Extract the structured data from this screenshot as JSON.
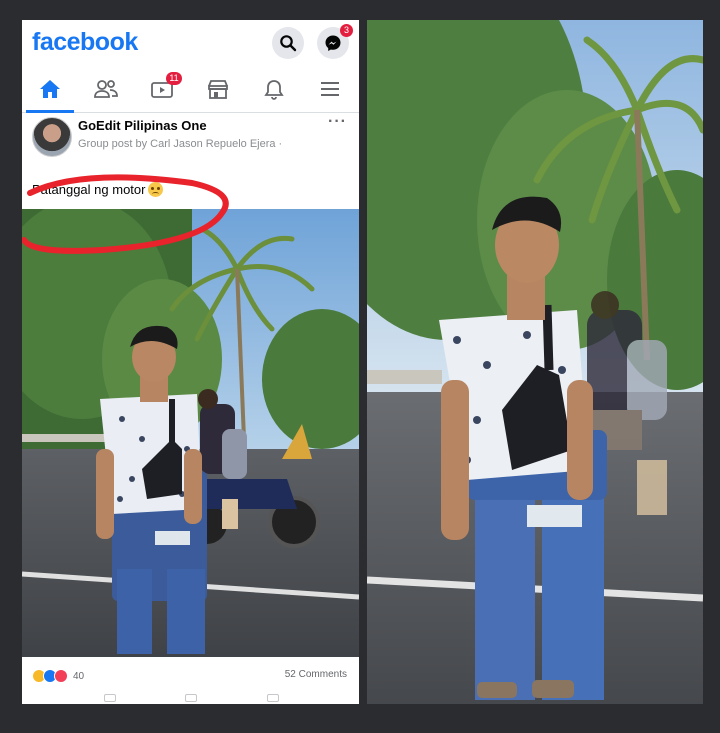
{
  "left_screenshot": {
    "brand": "facebook",
    "header_icons": [
      "search-icon",
      "messenger-icon"
    ],
    "messenger_badge": "3",
    "tabs": [
      {
        "name": "home",
        "icon": "home-icon",
        "active": true
      },
      {
        "name": "friends",
        "icon": "friends-icon"
      },
      {
        "name": "watch",
        "icon": "watch-icon",
        "badge": "11"
      },
      {
        "name": "marketplace",
        "icon": "marketplace-icon"
      },
      {
        "name": "notifications",
        "icon": "bell-icon"
      },
      {
        "name": "menu",
        "icon": "menu-icon"
      }
    ],
    "post": {
      "group_name": "GoEdit Pilipinas One",
      "subtitle": "Group post by Carl Jason Repuelo Ejera ·",
      "caption": "Patanggal ng motor",
      "reaction_count": "40",
      "comments": "52 Comments"
    },
    "accent_color": "#1877f2",
    "annotation_color": "#e8232b"
  }
}
